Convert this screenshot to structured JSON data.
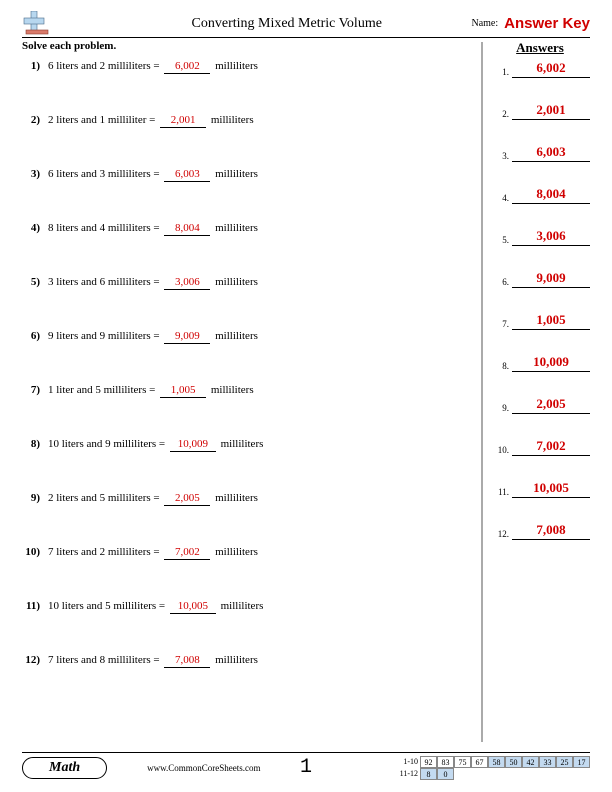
{
  "header": {
    "title": "Converting Mixed Metric Volume",
    "name_label": "Name:",
    "answer_key": "Answer Key"
  },
  "instructions": "Solve each problem.",
  "answers_heading": "Answers",
  "problems": [
    {
      "num": "1)",
      "pre": "6 liters and 2 milliliters = ",
      "ans": "6,002",
      "post": " milliliters"
    },
    {
      "num": "2)",
      "pre": "2 liters and 1 milliliter = ",
      "ans": "2,001",
      "post": " milliliters"
    },
    {
      "num": "3)",
      "pre": "6 liters and 3 milliliters = ",
      "ans": "6,003",
      "post": " milliliters"
    },
    {
      "num": "4)",
      "pre": "8 liters and 4 milliliters = ",
      "ans": "8,004",
      "post": " milliliters"
    },
    {
      "num": "5)",
      "pre": "3 liters and 6 milliliters = ",
      "ans": "3,006",
      "post": " milliliters"
    },
    {
      "num": "6)",
      "pre": "9 liters and 9 milliliters = ",
      "ans": "9,009",
      "post": " milliliters"
    },
    {
      "num": "7)",
      "pre": "1 liter and 5 milliliters = ",
      "ans": "1,005",
      "post": " milliliters"
    },
    {
      "num": "8)",
      "pre": "10 liters and 9 milliliters = ",
      "ans": "10,009",
      "post": " milliliters"
    },
    {
      "num": "9)",
      "pre": "2 liters and 5 milliliters = ",
      "ans": "2,005",
      "post": " milliliters"
    },
    {
      "num": "10)",
      "pre": "7 liters and 2 milliliters = ",
      "ans": "7,002",
      "post": " milliliters"
    },
    {
      "num": "11)",
      "pre": "10 liters and 5 milliliters = ",
      "ans": "10,005",
      "post": " milliliters"
    },
    {
      "num": "12)",
      "pre": "7 liters and 8 milliliters = ",
      "ans": "7,008",
      "post": " milliliters"
    }
  ],
  "answers": [
    {
      "n": "1.",
      "v": "6,002"
    },
    {
      "n": "2.",
      "v": "2,001"
    },
    {
      "n": "3.",
      "v": "6,003"
    },
    {
      "n": "4.",
      "v": "8,004"
    },
    {
      "n": "5.",
      "v": "3,006"
    },
    {
      "n": "6.",
      "v": "9,009"
    },
    {
      "n": "7.",
      "v": "1,005"
    },
    {
      "n": "8.",
      "v": "10,009"
    },
    {
      "n": "9.",
      "v": "2,005"
    },
    {
      "n": "10.",
      "v": "7,002"
    },
    {
      "n": "11.",
      "v": "10,005"
    },
    {
      "n": "12.",
      "v": "7,008"
    }
  ],
  "footer": {
    "subject": "Math",
    "site": "www.CommonCoreSheets.com",
    "page": "1",
    "grid": {
      "row1_label": "1-10",
      "row1": [
        "92",
        "83",
        "75",
        "67",
        "58",
        "50",
        "42",
        "33",
        "25",
        "17"
      ],
      "row2_label": "11-12",
      "row2": [
        "8",
        "0"
      ]
    }
  }
}
